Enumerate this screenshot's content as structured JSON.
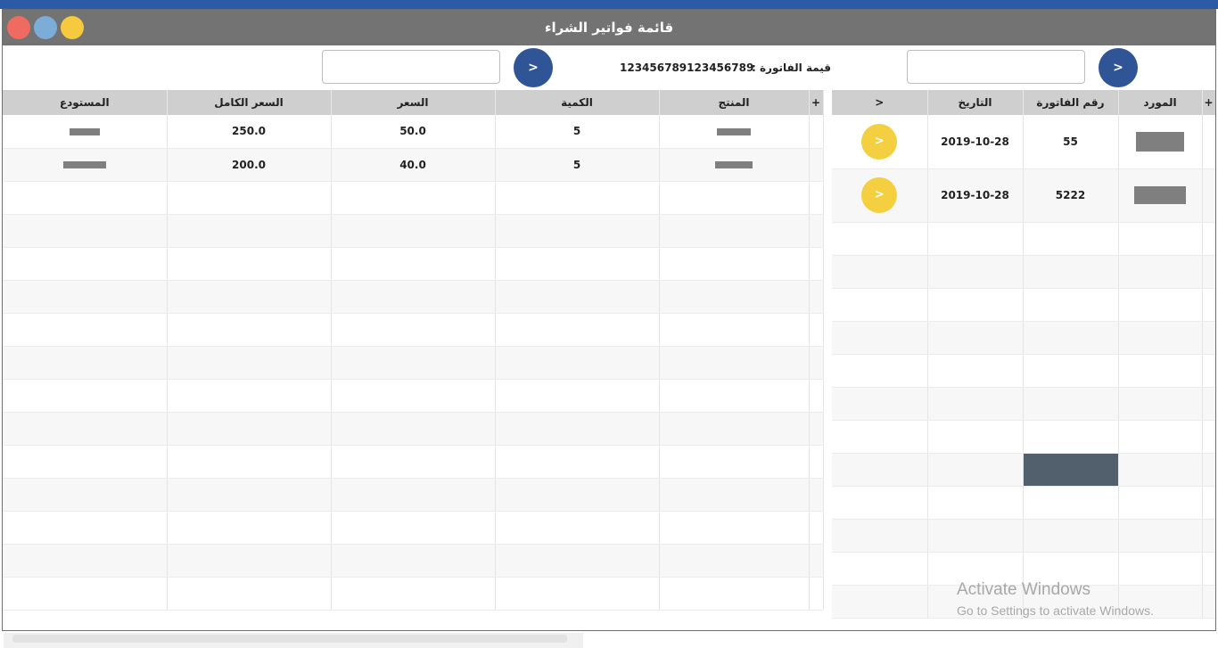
{
  "window": {
    "title": "قائمة فواتير الشراء"
  },
  "toolbar": {
    "amount_label": "قيمة الفاتورة :",
    "amount_value": "123456789123456789",
    "next_btn_left": ">",
    "next_btn_right": ">"
  },
  "details_table": {
    "headers": [
      "+",
      "المنتج",
      "الكمية",
      "السعر",
      "السعر الكامل",
      "المستودع"
    ],
    "rows": [
      {
        "quantity": "5",
        "price": "50.0",
        "total": "250.0"
      },
      {
        "quantity": "5",
        "price": "40.0",
        "total": "200.0"
      }
    ]
  },
  "invoices_table": {
    "headers": [
      "+",
      "المورد",
      "رقم الفاتورة",
      "التاريخ",
      ">"
    ],
    "rows": [
      {
        "invoice_no": "55",
        "date": "2019-10-28",
        "open_label": ">"
      },
      {
        "invoice_no": "5222",
        "date": "2019-10-28",
        "open_label": ">"
      }
    ]
  },
  "watermark": {
    "line1": "Activate Windows",
    "line2": "Go to Settings to activate Windows."
  },
  "colors": {
    "title_bar": "#737373",
    "accent_blue": "#2f5597",
    "accent_yellow": "#f4cf3f",
    "header_gray": "#cfcfcf",
    "selected_cell": "#52606e"
  }
}
